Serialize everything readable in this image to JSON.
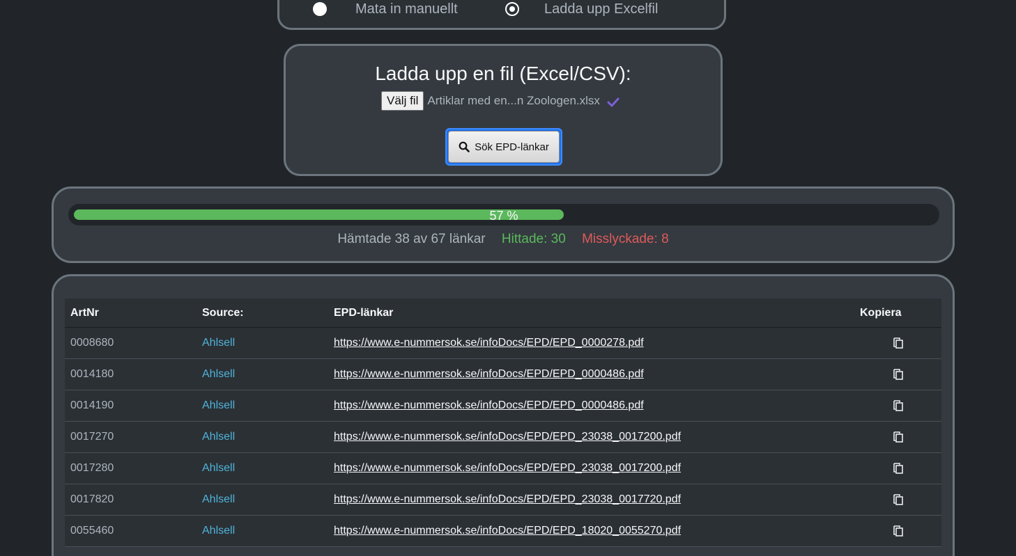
{
  "mode": {
    "options": [
      {
        "label": "Mata in manuellt",
        "checked": false
      },
      {
        "label": "Ladda upp Excelfil",
        "checked": true
      }
    ]
  },
  "upload": {
    "title": "Ladda upp en fil (Excel/CSV):",
    "choose_button": "Välj fil",
    "file_name": "Artiklar med en...n Zoologen.xlsx",
    "search_button": "Sök EPD-länkar"
  },
  "progress": {
    "percent": 57,
    "percent_label": "57 %",
    "fetched_text": "Hämtade 38 av 67 länkar",
    "found_text": "Hittade: 30",
    "failed_text": "Misslyckade: 8"
  },
  "colors": {
    "background": "#212529",
    "card": "#343a40",
    "progress": "#5cb85c",
    "found": "#5cb85c",
    "failed": "#e05a5a",
    "source_link": "#4fb3d9"
  },
  "table": {
    "headers": {
      "artnr": "ArtNr",
      "source": "Source:",
      "links": "EPD-länkar",
      "copy": "Kopiera"
    },
    "rows": [
      {
        "artnr": "0008680",
        "source": "Ahlsell",
        "link": "https://www.e-nummersok.se/infoDocs/EPD/EPD_0000278.pdf"
      },
      {
        "artnr": "0014180",
        "source": "Ahlsell",
        "link": "https://www.e-nummersok.se/infoDocs/EPD/EPD_0000486.pdf"
      },
      {
        "artnr": "0014190",
        "source": "Ahlsell",
        "link": "https://www.e-nummersok.se/infoDocs/EPD/EPD_0000486.pdf"
      },
      {
        "artnr": "0017270",
        "source": "Ahlsell",
        "link": "https://www.e-nummersok.se/infoDocs/EPD/EPD_23038_0017200.pdf"
      },
      {
        "artnr": "0017280",
        "source": "Ahlsell",
        "link": "https://www.e-nummersok.se/infoDocs/EPD/EPD_23038_0017200.pdf"
      },
      {
        "artnr": "0017820",
        "source": "Ahlsell",
        "link": "https://www.e-nummersok.se/infoDocs/EPD/EPD_23038_0017720.pdf"
      },
      {
        "artnr": "0055460",
        "source": "Ahlsell",
        "link": "https://www.e-nummersok.se/infoDocs/EPD/EPD_18020_0055270.pdf"
      }
    ]
  }
}
